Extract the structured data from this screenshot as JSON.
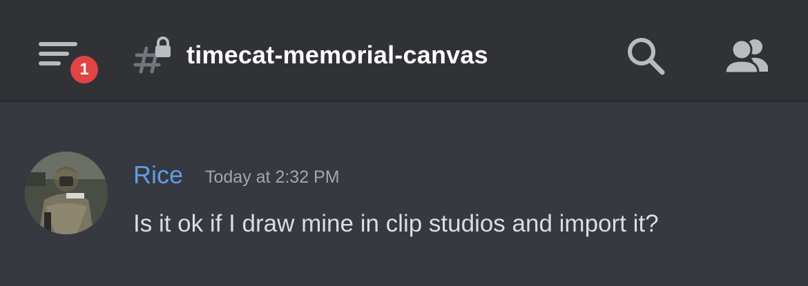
{
  "header": {
    "menu_badge_count": "1",
    "channel_name": "timecat-memorial-canvas",
    "channel_icon": "locked-text-channel-icon",
    "search_icon": "search-icon",
    "members_icon": "members-icon"
  },
  "message": {
    "author": "Rice",
    "timestamp": "Today at 2:32 PM",
    "content": "Is it ok if I draw mine in clip studios and import it?",
    "author_color": "#5d9ee6"
  },
  "colors": {
    "background": "#36393f",
    "header_background": "#303236",
    "badge": "#e04444",
    "text": "#dcddde",
    "muted_text": "#a3a6aa"
  }
}
